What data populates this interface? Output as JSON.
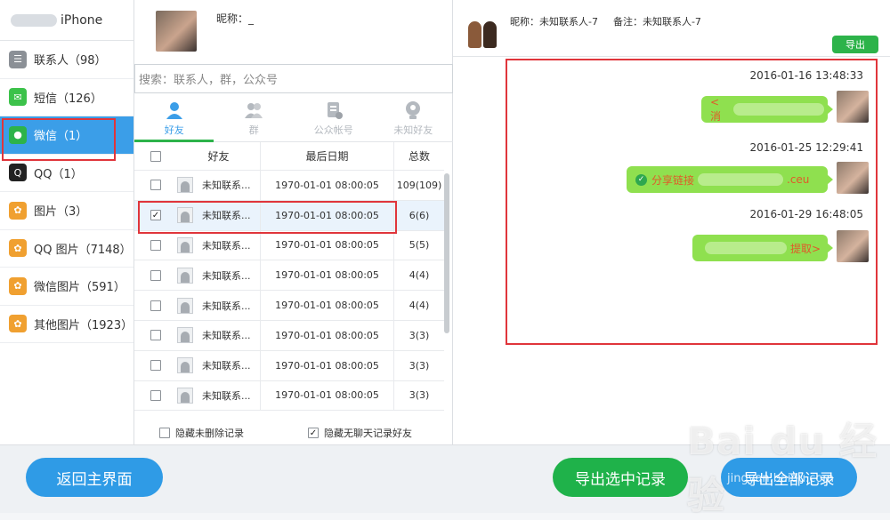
{
  "device": {
    "name": "iPhone"
  },
  "sidebar": {
    "items": [
      {
        "label": "联系人（98）",
        "icon": "contacts-icon",
        "color": "#8b9096"
      },
      {
        "label": "短信（126）",
        "icon": "sms-icon",
        "color": "#3cc24a"
      },
      {
        "label": "微信（1）",
        "icon": "wechat-icon",
        "color": "#2db34a"
      },
      {
        "label": "QQ（1）",
        "icon": "qq-icon",
        "color": "#222222"
      },
      {
        "label": "图片（3）",
        "icon": "photos-icon",
        "color": "#f0a030"
      },
      {
        "label": "QQ 图片（7148）",
        "icon": "qq-photos-icon",
        "color": "#f0a030"
      },
      {
        "label": "微信图片（591）",
        "icon": "wechat-photos-icon",
        "color": "#f0a030"
      },
      {
        "label": "其他图片（1923）",
        "icon": "other-photos-icon",
        "color": "#f0a030"
      }
    ]
  },
  "profile": {
    "nickname_label": "昵称：_"
  },
  "search": {
    "placeholder": "搜索：联系人，群，公众号"
  },
  "tabs": [
    {
      "label": "好友",
      "icon": "person-icon"
    },
    {
      "label": "群",
      "icon": "group-icon"
    },
    {
      "label": "公众帐号",
      "icon": "official-account-icon"
    },
    {
      "label": "未知好友",
      "icon": "unknown-friend-icon"
    }
  ],
  "table": {
    "headers": {
      "friend": "好友",
      "date": "最后日期",
      "total": "总数"
    },
    "rows": [
      {
        "name": "未知联系...",
        "date": "1970-01-01 08:00:05",
        "total": "109(109)",
        "checked": false
      },
      {
        "name": "未知联系...",
        "date": "1970-01-01 08:00:05",
        "total": "6(6)",
        "checked": true
      },
      {
        "name": "未知联系...",
        "date": "1970-01-01 08:00:05",
        "total": "5(5)",
        "checked": false
      },
      {
        "name": "未知联系...",
        "date": "1970-01-01 08:00:05",
        "total": "4(4)",
        "checked": false
      },
      {
        "name": "未知联系...",
        "date": "1970-01-01 08:00:05",
        "total": "4(4)",
        "checked": false
      },
      {
        "name": "未知联系...",
        "date": "1970-01-01 08:00:05",
        "total": "3(3)",
        "checked": false
      },
      {
        "name": "未知联系...",
        "date": "1970-01-01 08:00:05",
        "total": "3(3)",
        "checked": false
      },
      {
        "name": "未知联系...",
        "date": "1970-01-01 08:00:05",
        "total": "3(3)",
        "checked": false
      }
    ]
  },
  "filters": {
    "hide_deleted": "隐藏未删除记录",
    "hide_no_chat": "隐藏无聊天记录好友"
  },
  "chat": {
    "header": {
      "nickname": "昵称：未知联系人-7",
      "note": "备注：未知联系人-7"
    },
    "export_label": "导出",
    "messages": [
      {
        "time": "2016-01-16 13:48:33",
        "prefix": "<消",
        "suffix": ""
      },
      {
        "time": "2016-01-25 12:29:41",
        "prefix": "分享链接",
        "suffix": ".ceu"
      },
      {
        "time": "2016-01-29 16:48:05",
        "prefix": "",
        "suffix": "提取>"
      }
    ]
  },
  "bottom": {
    "back_label": "返回主界面",
    "export_selected_label": "导出选中记录",
    "export_all_label": "导出全部记录"
  },
  "watermark": {
    "main": "Bai du 经验",
    "sub": "jingyan.baidu.com"
  },
  "colors": {
    "accent_blue": "#3b9ee8",
    "accent_green": "#2db34a",
    "highlight_red": "#e0353b",
    "bubble_green": "#8fe04f"
  }
}
